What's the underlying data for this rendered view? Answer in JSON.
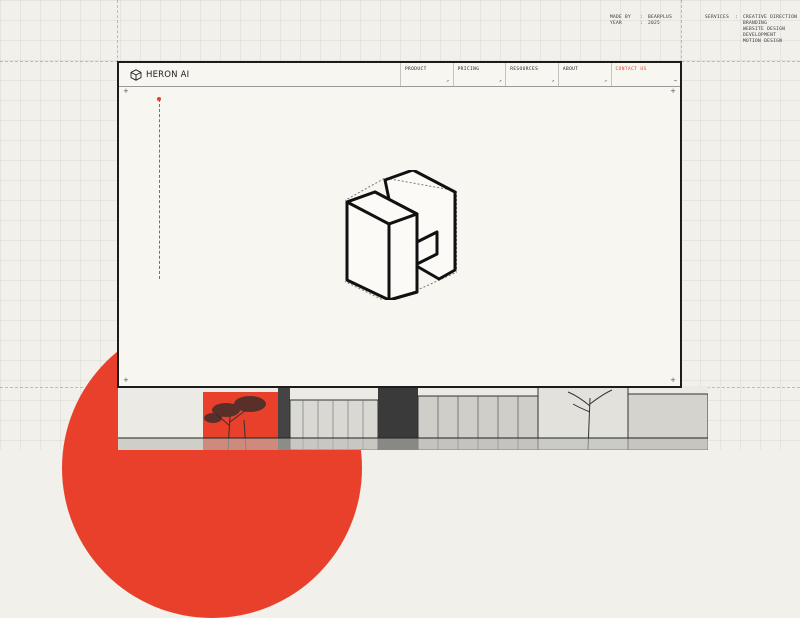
{
  "meta": {
    "made_by_label": "MADE BY",
    "made_by_value": "BEARPLUS",
    "year_label": "YEAR",
    "year_value": "2025",
    "services_label": "SERVICES",
    "services": [
      "CREATIVE DIRECTION",
      "BRANDING",
      "WEBSITE DESIGN",
      "DEVELOPMENT",
      "MOTION DESIGN"
    ]
  },
  "site": {
    "brand": "HERON AI",
    "nav": [
      {
        "label": "PRODUCT"
      },
      {
        "label": "PRICING"
      },
      {
        "label": "RESOURCES"
      },
      {
        "label": "ABOUT"
      }
    ],
    "contact_label": "CONTACT US",
    "arrow": "↗",
    "contact_arrow": "→"
  },
  "colors": {
    "accent": "#e8402a",
    "background": "#f1f0ea",
    "window": "#f7f6f1",
    "ink": "#1c1c1c"
  },
  "icons": [
    "logo-cube-icon",
    "hero-h-logo-icon",
    "arrow-icon",
    "plus-marker-icon"
  ]
}
